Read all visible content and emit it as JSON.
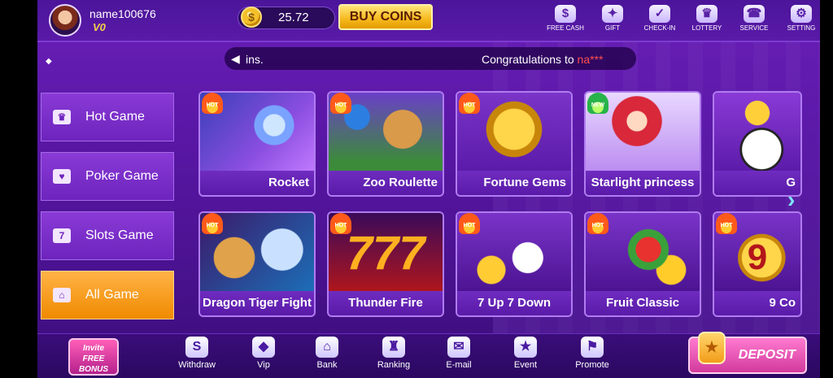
{
  "header": {
    "username": "name100676",
    "vip_level": "V0",
    "balance": "25.72",
    "buy_coins_label": "BUY COINS",
    "icons": [
      {
        "label": "FREE CASH",
        "icon": "free-cash-icon",
        "glyph": "$"
      },
      {
        "label": "GIFT",
        "icon": "gift-icon",
        "glyph": "✦"
      },
      {
        "label": "CHECK-IN",
        "icon": "check-in-icon",
        "glyph": "✓"
      },
      {
        "label": "LOTTERY",
        "icon": "lottery-icon",
        "glyph": "♛"
      },
      {
        "label": "SERVICE",
        "icon": "service-icon",
        "glyph": "☎"
      },
      {
        "label": "SETTING",
        "icon": "setting-icon",
        "glyph": "⚙"
      }
    ]
  },
  "marquee": {
    "left_text": "ins.",
    "right_text_prefix": "Congratulations to ",
    "right_text_name": "na***"
  },
  "categories": [
    {
      "label": "Hot Game",
      "icon": "crown-icon",
      "glyph": "♛",
      "active": false
    },
    {
      "label": "Poker Game",
      "icon": "poker-icon",
      "glyph": "♥",
      "active": false
    },
    {
      "label": "Slots Game",
      "icon": "slots-icon",
      "glyph": "7",
      "active": false
    },
    {
      "label": "All Game",
      "icon": "home-icon",
      "glyph": "⌂",
      "active": true
    }
  ],
  "games_row1": [
    {
      "name": "Rocket",
      "badge": "HOT"
    },
    {
      "name": "Zoo Roulette",
      "badge": "HOT"
    },
    {
      "name": "Fortune Gems",
      "badge": "HOT"
    },
    {
      "name": "Starlight princess",
      "badge": "NEW"
    },
    {
      "name": "G",
      "badge": ""
    }
  ],
  "games_row2": [
    {
      "name": "Dragon Tiger Fight",
      "badge": "HOT"
    },
    {
      "name": "Thunder Fire",
      "badge": "HOT"
    },
    {
      "name": "7 Up 7 Down",
      "badge": "HOT"
    },
    {
      "name": "Fruit Classic",
      "badge": "HOT"
    },
    {
      "name": "9 Co",
      "badge": "HOT"
    }
  ],
  "bottom_nav": [
    {
      "label": "Withdraw",
      "icon": "withdraw-icon",
      "glyph": "S"
    },
    {
      "label": "Vip",
      "icon": "vip-icon",
      "glyph": "◆"
    },
    {
      "label": "Bank",
      "icon": "bank-icon",
      "glyph": "⌂"
    },
    {
      "label": "Ranking",
      "icon": "ranking-icon",
      "glyph": "♜"
    },
    {
      "label": "E-mail",
      "icon": "email-icon",
      "glyph": "✉"
    },
    {
      "label": "Event",
      "icon": "event-icon",
      "glyph": "★"
    },
    {
      "label": "Promote",
      "icon": "promote-icon",
      "glyph": "⚑"
    }
  ],
  "invite_label_1": "Invite",
  "invite_label_2": "FREE",
  "invite_label_3": "BONUS",
  "deposit_label": "DEPOSIT",
  "colors": {
    "accent": "#f6b91c",
    "hot_badge": "#ff5a1a",
    "new_badge": "#27b34a"
  }
}
